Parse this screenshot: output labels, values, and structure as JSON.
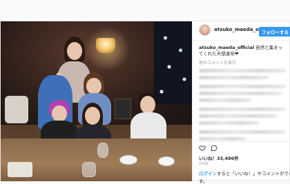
{
  "header": {
    "username": "atsuko_maeda_offic",
    "follow_label": "フォローする"
  },
  "caption": {
    "username": "atsuko_maeda_official",
    "text": " 自然と集まってくれた天使達😆❤"
  },
  "comments": {
    "more_label": "他のコメントを表示"
  },
  "actions": {
    "likes_label": "いいね！33,486件",
    "time_ago": "4日前"
  },
  "login": {
    "link_label": "ログイン",
    "text": "すると「いいね！」やコメントができま",
    "text_cont": "す。"
  },
  "colors": {
    "accent": "#3897f0",
    "text": "#262626",
    "muted": "#999999"
  }
}
